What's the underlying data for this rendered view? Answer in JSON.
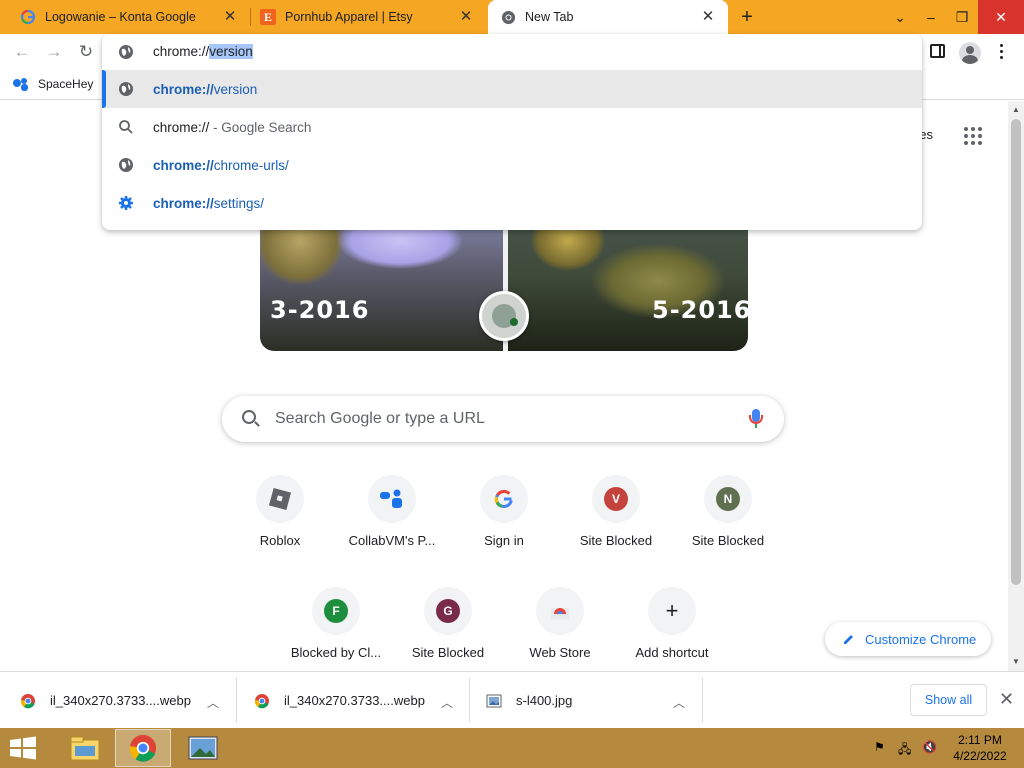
{
  "tabs": [
    {
      "title": "Logowanie – Konta Google",
      "icon": "google-g-icon"
    },
    {
      "title": "Pornhub Apparel | Etsy",
      "icon": "etsy-e-icon"
    },
    {
      "title": "New Tab",
      "icon": "chrome-icon"
    }
  ],
  "omnibox": {
    "typed_prefix": "chrome://",
    "autocomplete_selected": "version",
    "suggestions": [
      {
        "icon": "globe-icon",
        "bold": "chrome://",
        "rest": "version"
      },
      {
        "icon": "search-icon",
        "bold": "chrome://",
        "rest": " - Google Search"
      },
      {
        "icon": "globe-icon",
        "bold": "chrome://",
        "rest": "chrome-urls/"
      },
      {
        "icon": "gear-icon",
        "bold": "chrome://",
        "rest": "settings/"
      }
    ]
  },
  "bookmarks": [
    {
      "label": "SpaceHey"
    }
  ],
  "ntp": {
    "images_link": "ges",
    "doodle": {
      "left_label": "3-2016",
      "right_label": "5-2016"
    },
    "search_placeholder": "Search Google or type a URL",
    "shortcuts": [
      {
        "label": "Roblox",
        "letter": "",
        "kind": "roblox"
      },
      {
        "label": "CollabVM's P...",
        "letter": "",
        "kind": "collab"
      },
      {
        "label": "Sign in",
        "letter": "",
        "kind": "google"
      },
      {
        "label": "Site Blocked",
        "letter": "V",
        "kind": "letter",
        "color": "#c5433d"
      },
      {
        "label": "Site Blocked",
        "letter": "N",
        "kind": "letter",
        "color": "#5f7050"
      },
      {
        "label": "Blocked by Cl...",
        "letter": "F",
        "kind": "letter",
        "color": "#1e8e3e"
      },
      {
        "label": "Site Blocked",
        "letter": "G",
        "kind": "letter",
        "color": "#7b2b4a"
      },
      {
        "label": "Web Store",
        "letter": "",
        "kind": "webstore"
      },
      {
        "label": "Add shortcut",
        "letter": "+",
        "kind": "add"
      }
    ],
    "customize_label": "Customize Chrome"
  },
  "downloads": [
    {
      "name": "il_340x270.3733....webp",
      "icon": "chrome-file-icon"
    },
    {
      "name": "il_340x270.3733....webp",
      "icon": "chrome-file-icon"
    },
    {
      "name": "s-l400.jpg",
      "icon": "image-file-icon"
    }
  ],
  "downloads_show_all": "Show all",
  "taskbar": {
    "time": "2:11 PM",
    "date": "4/22/2022"
  },
  "colors": {
    "titlebar": "#f5a623",
    "taskbar": "#b58a3e",
    "accent": "#1a73e8"
  }
}
